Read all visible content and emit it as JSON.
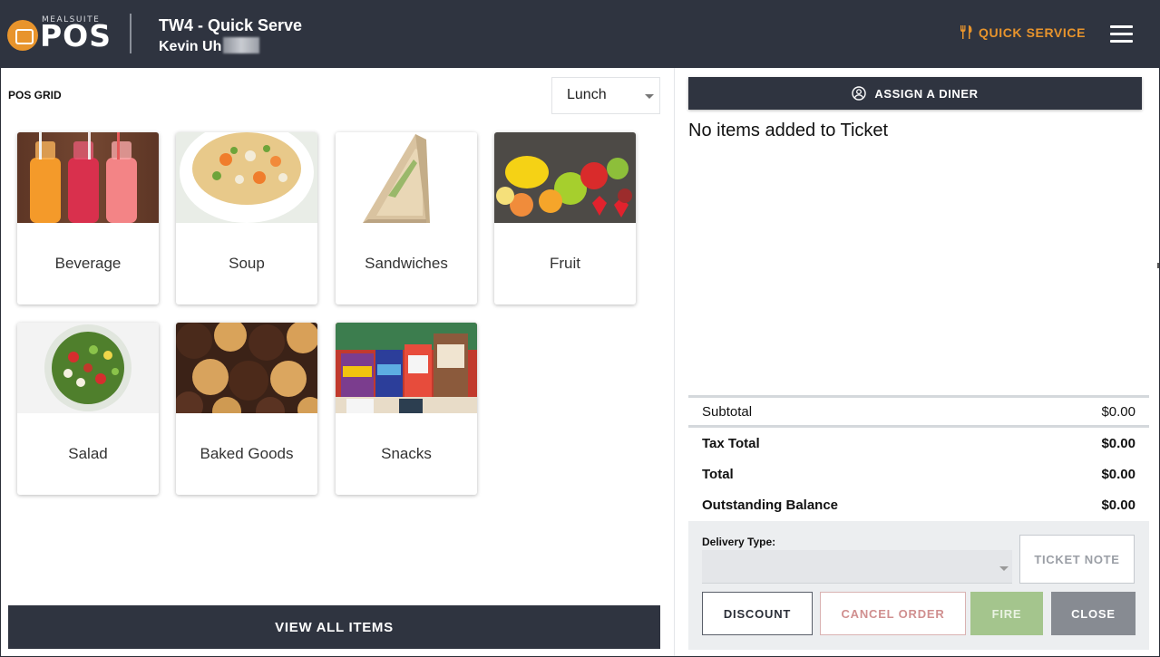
{
  "header": {
    "logo_small": "MEALSUITE",
    "logo_main": "POS",
    "title": "TW4 - Quick Serve",
    "user": "Kevin Uh",
    "service_mode": "QUICK SERVICE",
    "accent_color": "#e8942c",
    "icons": {
      "service": "fork-knife-icon",
      "menu": "hamburger-menu-icon"
    }
  },
  "left": {
    "grid_label": "POS GRID",
    "meal_period": "Lunch",
    "tiles": [
      {
        "label": "Beverage"
      },
      {
        "label": "Soup"
      },
      {
        "label": "Sandwiches"
      },
      {
        "label": "Fruit"
      },
      {
        "label": "Salad"
      },
      {
        "label": "Baked Goods"
      },
      {
        "label": "Snacks"
      }
    ],
    "view_all": "VIEW ALL ITEMS"
  },
  "right": {
    "assign_diner": "ASSIGN A DINER",
    "empty_message": "No items added to Ticket",
    "totals": {
      "subtotal_label": "Subtotal",
      "subtotal": "$0.00",
      "tax_label": "Tax Total",
      "tax": "$0.00",
      "total_label": "Total",
      "total": "$0.00",
      "balance_label": "Outstanding Balance",
      "balance": "$0.00"
    },
    "delivery_label": "Delivery Type:",
    "delivery_value": "",
    "buttons": {
      "ticket_note": "TICKET NOTE",
      "discount": "DISCOUNT",
      "cancel_order": "CANCEL ORDER",
      "fire": "FIRE",
      "close": "CLOSE"
    }
  }
}
